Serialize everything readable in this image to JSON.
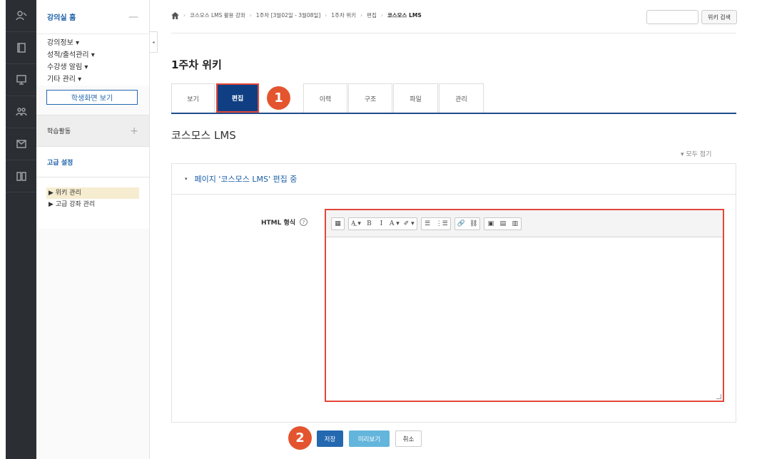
{
  "sidebar": {
    "home_title": "강의실 홈",
    "home_toggle": "—",
    "menu": [
      "강의정보 ▾",
      "성적/출석관리 ▾",
      "수강생 알림 ▾",
      "기타 관리 ▾"
    ],
    "student_view_button": "학생화면 보기",
    "activities_label": "학습활동",
    "activities_toggle": "+",
    "advanced_label": "고급 설정",
    "tree": [
      "▶ 위키 관리",
      "▶ 고급 강좌 관리"
    ],
    "collapse_tab": "◂"
  },
  "breadcrumb": {
    "home_icon": "home-icon",
    "items": [
      "코스모스 LMS 활용 강좌",
      "1주차 [3월02일 - 3월08일]",
      "1주차 위키",
      "편집"
    ],
    "current": "코스모스 LMS",
    "separator": "›"
  },
  "search": {
    "button": "위키 검색",
    "placeholder": ""
  },
  "page_title": "1주차 위키",
  "tabs": [
    "보기",
    "편집",
    "이력",
    "구조",
    "파일",
    "관리"
  ],
  "badges": {
    "one": "1",
    "two": "2"
  },
  "wiki_title": "코스모스 LMS",
  "collapse_all": "▾ 모두 접기",
  "panel": {
    "caret": "▾",
    "title": "페이지 '코스모스 LMS' 편집 중",
    "field_label": "HTML 형식",
    "help": "?"
  },
  "toolbar": {
    "groups": [
      [
        "▦"
      ],
      [
        "A͟ ▾",
        "B",
        "I",
        "A ▾",
        "✐ ▾"
      ],
      [
        "☰",
        "⋮☰"
      ],
      [
        "🔗",
        "⛓"
      ],
      [
        "▣",
        "▤",
        "▥"
      ]
    ]
  },
  "buttons": {
    "save": "저장",
    "preview": "미리보기",
    "cancel": "취소"
  },
  "colors": {
    "accent": "#0f3f82",
    "highlight": "#e4463a",
    "badge": "#e4552f",
    "link": "#1a5fa8"
  }
}
